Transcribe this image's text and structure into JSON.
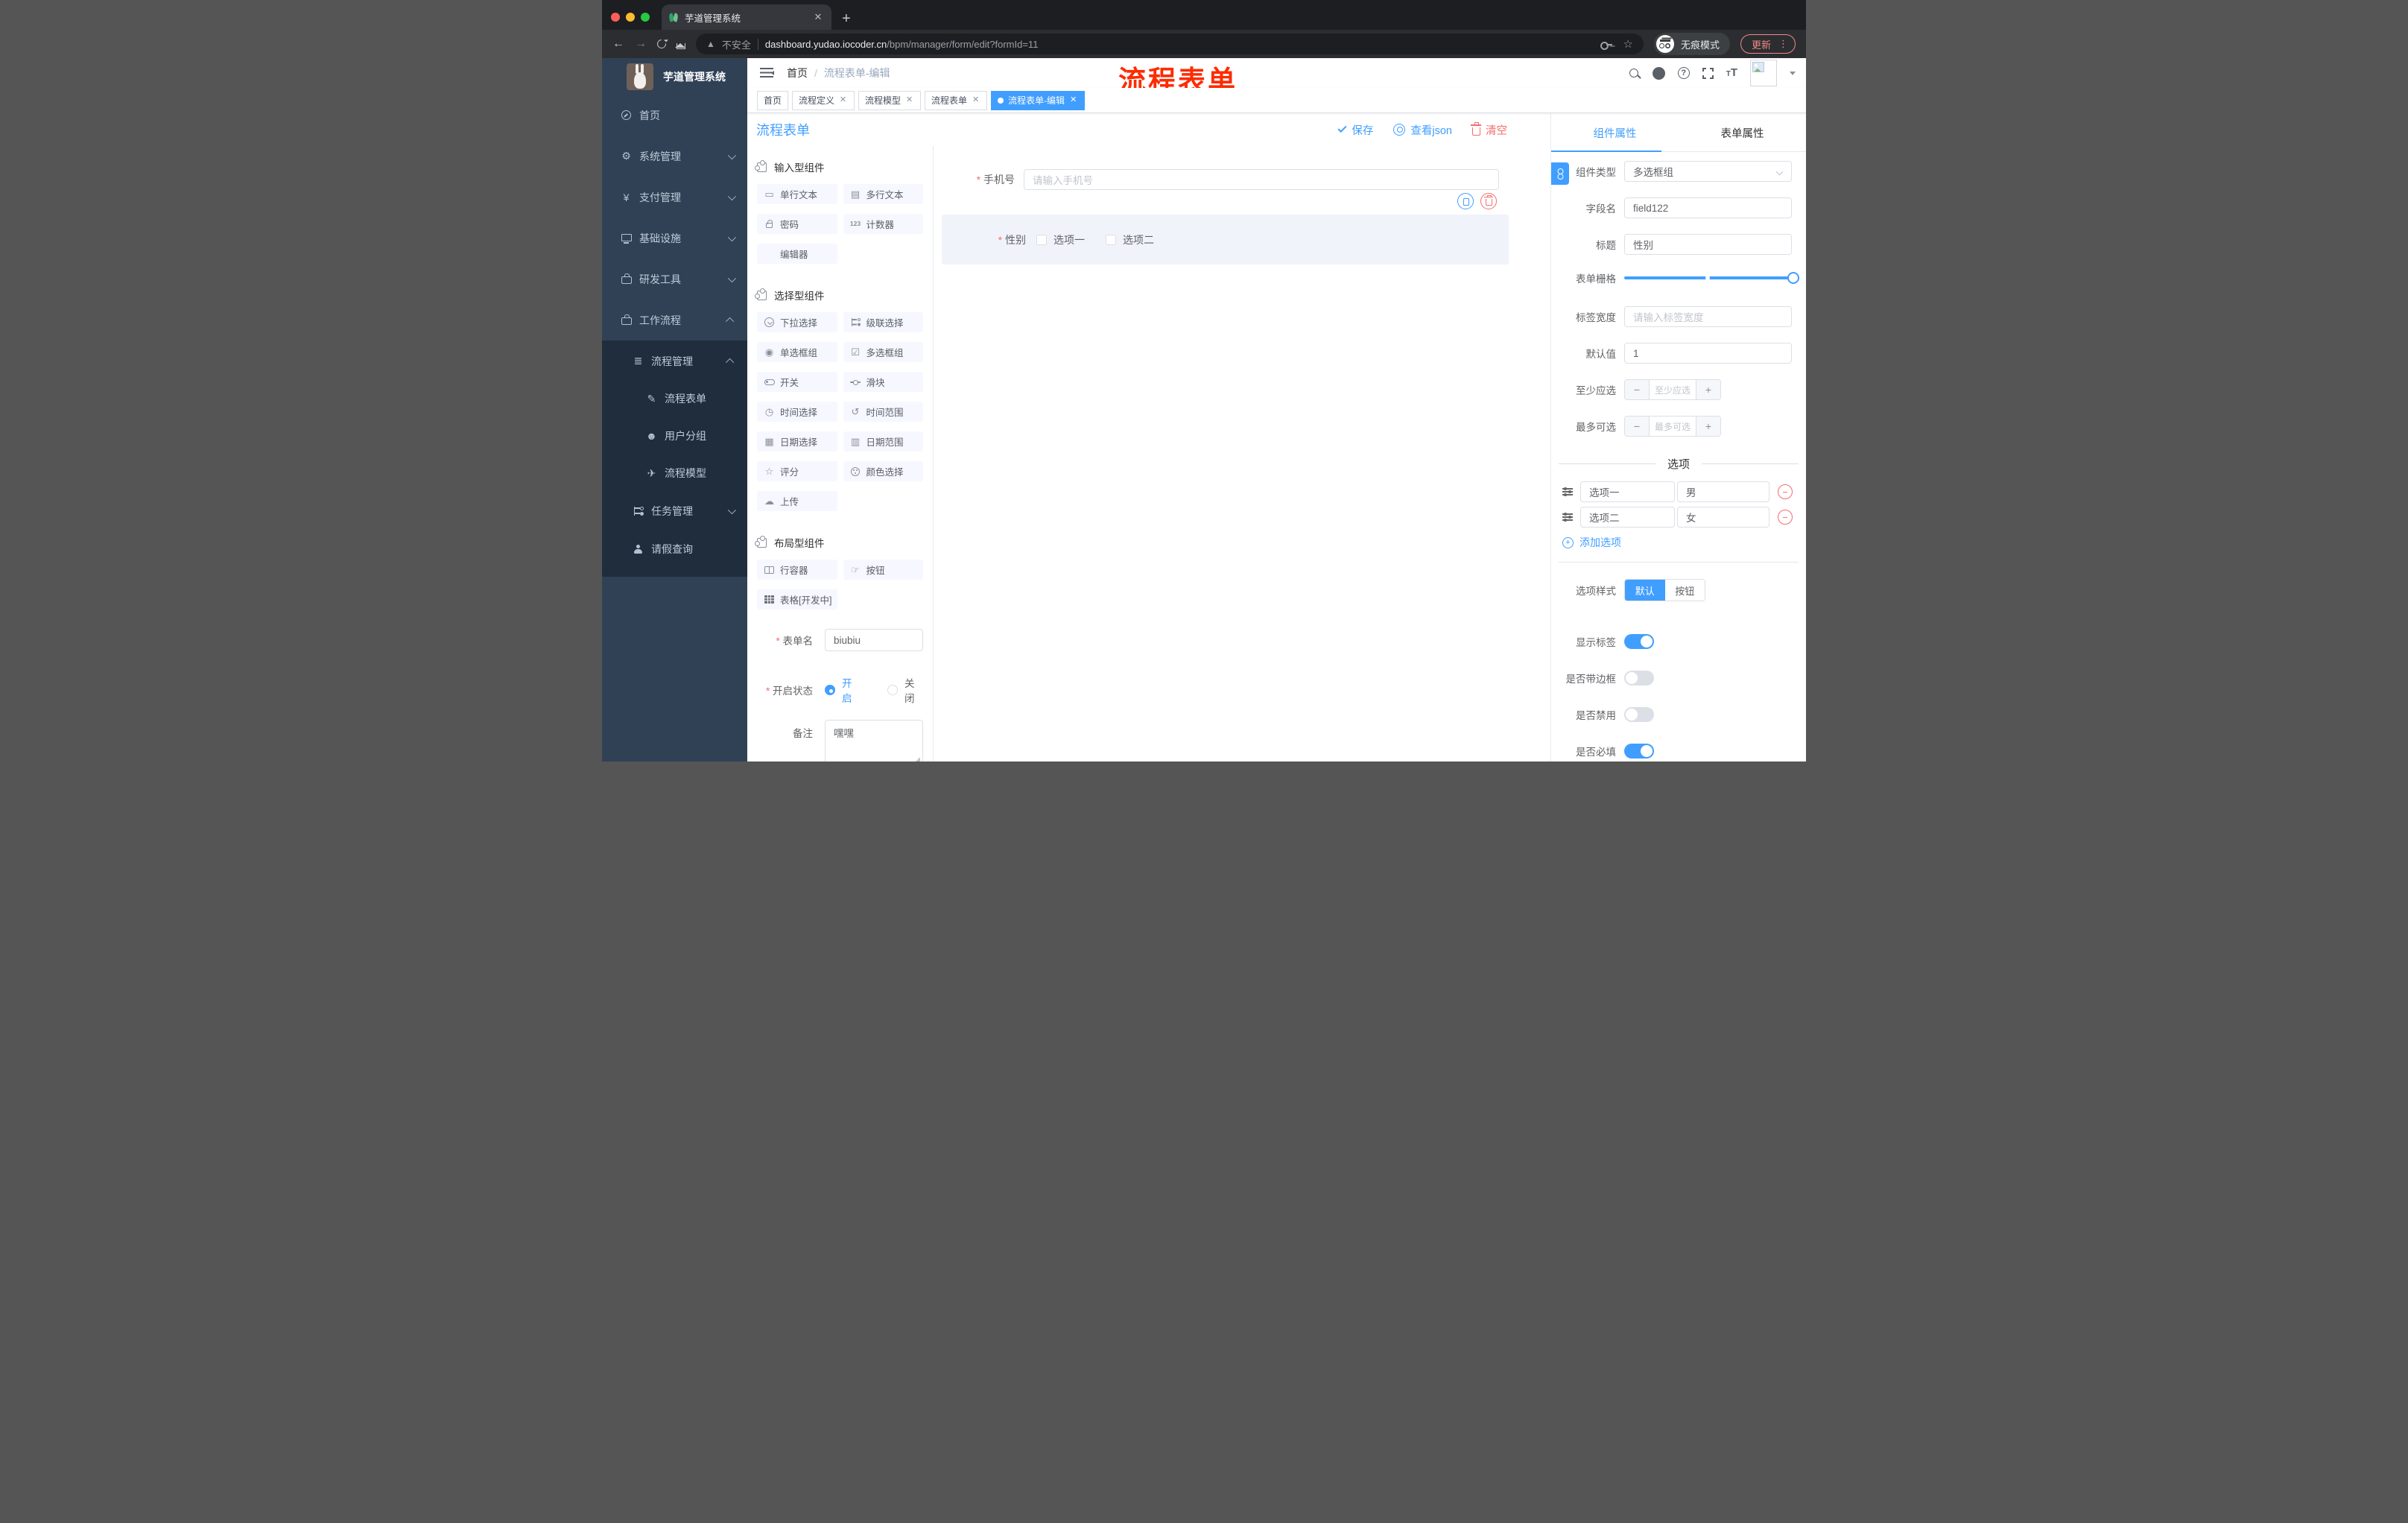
{
  "accent_color": "#409eff",
  "browser": {
    "tab_title": "芋道管理系统",
    "security_label": "不安全",
    "url_host": "dashboard.yudao.iocoder.cn",
    "url_path": "/bpm/manager/form/edit?formId=11",
    "incognito_label": "无痕模式",
    "update_label": "更新",
    "kebab": "⋮"
  },
  "sidebar": {
    "logo_title": "芋道管理系统",
    "items": [
      {
        "label": "首页"
      },
      {
        "label": "系统管理"
      },
      {
        "label": "支付管理"
      },
      {
        "label": "基础设施"
      },
      {
        "label": "研发工具"
      },
      {
        "label": "工作流程"
      },
      {
        "label": "流程管理"
      },
      {
        "label": "流程表单"
      },
      {
        "label": "用户分组"
      },
      {
        "label": "流程模型"
      },
      {
        "label": "任务管理"
      },
      {
        "label": "请假查询"
      }
    ]
  },
  "header": {
    "breadcrumb": [
      "首页",
      "流程表单-编辑"
    ],
    "annotation": "流程表单",
    "annotation_color": "#fe2b00"
  },
  "tags": [
    {
      "label": "首页"
    },
    {
      "label": "流程定义"
    },
    {
      "label": "流程模型"
    },
    {
      "label": "流程表单"
    },
    {
      "label": "流程表单-编辑"
    }
  ],
  "designer": {
    "title": "流程表单",
    "actions": {
      "save": "保存",
      "view_json": "查看json",
      "clear": "清空"
    },
    "groups": [
      {
        "title": "输入型组件",
        "items": [
          "单行文本",
          "多行文本",
          "密码",
          "计数器",
          "编辑器"
        ]
      },
      {
        "title": "选择型组件",
        "items": [
          "下拉选择",
          "级联选择",
          "单选框组",
          "多选框组",
          "开关",
          "滑块",
          "时间选择",
          "时间范围",
          "日期选择",
          "日期范围",
          "评分",
          "颜色选择",
          "上传"
        ]
      },
      {
        "title": "布局型组件",
        "items": [
          "行容器",
          "按钮",
          "表格[开发中]"
        ]
      }
    ],
    "meta_form": {
      "name_label": "表单名",
      "name_value": "biubiu",
      "status_label": "开启状态",
      "status_on": "开启",
      "status_off": "关闭",
      "remark_label": "备注",
      "remark_value": "嘿嘿"
    }
  },
  "canvas": {
    "phone": {
      "label": "手机号",
      "placeholder": "请输入手机号"
    },
    "gender": {
      "label": "性别",
      "options": [
        "选项一",
        "选项二"
      ]
    }
  },
  "panel": {
    "tabs": [
      "组件属性",
      "表单属性"
    ],
    "fields": {
      "component_type": {
        "label": "组件类型",
        "value": "多选框组"
      },
      "field_name": {
        "label": "字段名",
        "value": "field122"
      },
      "title": {
        "label": "标题",
        "value": "性别"
      },
      "grid": {
        "label": "表单栅格"
      },
      "label_width": {
        "label": "标签宽度",
        "placeholder": "请输入标签宽度"
      },
      "default_value": {
        "label": "默认值",
        "value": "1"
      },
      "min_select": {
        "label": "至少应选",
        "placeholder": "至少应选"
      },
      "max_select": {
        "label": "最多可选",
        "placeholder": "最多可选"
      }
    },
    "options_divider": "选项",
    "options": [
      {
        "label": "选项一",
        "value": "男"
      },
      {
        "label": "选项二",
        "value": "女"
      }
    ],
    "add_option": "添加选项",
    "option_style": {
      "label": "选项样式",
      "choices": [
        "默认",
        "按钮"
      ],
      "active": "默认"
    },
    "switches": [
      {
        "label": "显示标签",
        "on": true
      },
      {
        "label": "是否带边框",
        "on": false
      },
      {
        "label": "是否禁用",
        "on": false
      },
      {
        "label": "是否必填",
        "on": true
      }
    ]
  }
}
